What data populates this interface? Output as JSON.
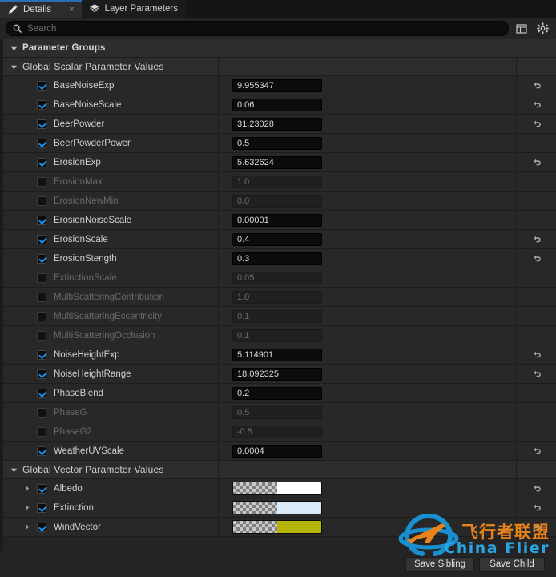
{
  "window": {
    "tabs": [
      {
        "label": "Details",
        "icon": "pencil-icon",
        "active": true,
        "close": "×"
      },
      {
        "label": "Layer Parameters",
        "icon": "layers-icon",
        "active": false
      }
    ]
  },
  "search": {
    "placeholder": "Search",
    "value": "",
    "icon": "search-icon"
  },
  "toolbar": {
    "columns_icon": "table-columns-icon",
    "settings_icon": "gear-icon"
  },
  "groups": [
    {
      "label": "Parameter Groups",
      "expanded": true,
      "level": 0
    },
    {
      "label": "Global Scalar Parameter Values",
      "expanded": true,
      "level": 1
    },
    {
      "label": "Global Vector Parameter Values",
      "expanded": true,
      "level": 1
    }
  ],
  "scalar_parameters": [
    {
      "name": "BaseNoiseExp",
      "value": "9.955347",
      "checked": true,
      "enabled": true,
      "reset": true
    },
    {
      "name": "BaseNoiseScale",
      "value": "0.06",
      "checked": true,
      "enabled": true,
      "reset": true
    },
    {
      "name": "BeerPowder",
      "value": "31.23028",
      "checked": true,
      "enabled": true,
      "reset": true
    },
    {
      "name": "BeerPowderPower",
      "value": "0.5",
      "checked": true,
      "enabled": true,
      "reset": false
    },
    {
      "name": "ErosionExp",
      "value": "5.632624",
      "checked": true,
      "enabled": true,
      "reset": true
    },
    {
      "name": "ErosionMax",
      "value": "1.0",
      "checked": false,
      "enabled": false,
      "reset": false
    },
    {
      "name": "ErosionNewMin",
      "value": "0.0",
      "checked": false,
      "enabled": false,
      "reset": false
    },
    {
      "name": "ErosionNoiseScale",
      "value": "0.00001",
      "checked": true,
      "enabled": true,
      "reset": false
    },
    {
      "name": "ErosionScale",
      "value": "0.4",
      "checked": true,
      "enabled": true,
      "reset": true
    },
    {
      "name": "ErosionStength",
      "value": "0.3",
      "checked": true,
      "enabled": true,
      "reset": true
    },
    {
      "name": "ExtinctionScale",
      "value": "0.05",
      "checked": false,
      "enabled": false,
      "reset": false
    },
    {
      "name": "MultiScatteringContribution",
      "value": "1.0",
      "checked": false,
      "enabled": false,
      "reset": false
    },
    {
      "name": "MultiScatteringEccentricity",
      "value": "0.1",
      "checked": false,
      "enabled": false,
      "reset": false
    },
    {
      "name": "MultiScatteringOcclusion",
      "value": "0.1",
      "checked": false,
      "enabled": false,
      "reset": false
    },
    {
      "name": "NoiseHeightExp",
      "value": "5.114901",
      "checked": true,
      "enabled": true,
      "reset": true
    },
    {
      "name": "NoiseHeightRange",
      "value": "18.092325",
      "checked": true,
      "enabled": true,
      "reset": true
    },
    {
      "name": "PhaseBlend",
      "value": "0.2",
      "checked": true,
      "enabled": true,
      "reset": false
    },
    {
      "name": "PhaseG",
      "value": "0.5",
      "checked": false,
      "enabled": false,
      "reset": false
    },
    {
      "name": "PhaseG2",
      "value": "-0.5",
      "checked": false,
      "enabled": false,
      "reset": false
    },
    {
      "name": "WeatherUVScale",
      "value": "0.0004",
      "checked": true,
      "enabled": true,
      "reset": true
    }
  ],
  "vector_parameters": [
    {
      "name": "Albedo",
      "color": "#ffffff",
      "checked": true,
      "expanded": false,
      "reset": true
    },
    {
      "name": "Extinction",
      "color": "#daeaf8",
      "checked": true,
      "expanded": false,
      "reset": true
    },
    {
      "name": "WindVector",
      "color": "#b5b506",
      "checked": true,
      "expanded": false,
      "reset": true
    }
  ],
  "footer": {
    "save_sibling_label": "Save Sibling",
    "save_child_label": "Save Child"
  },
  "watermark": {
    "chinese": "飞行者联盟",
    "english": "China Flier",
    "logo_icon": "airplane-orbit-logo-icon",
    "color_orange": "#e8821a",
    "color_blue": "#2aa3e0"
  }
}
